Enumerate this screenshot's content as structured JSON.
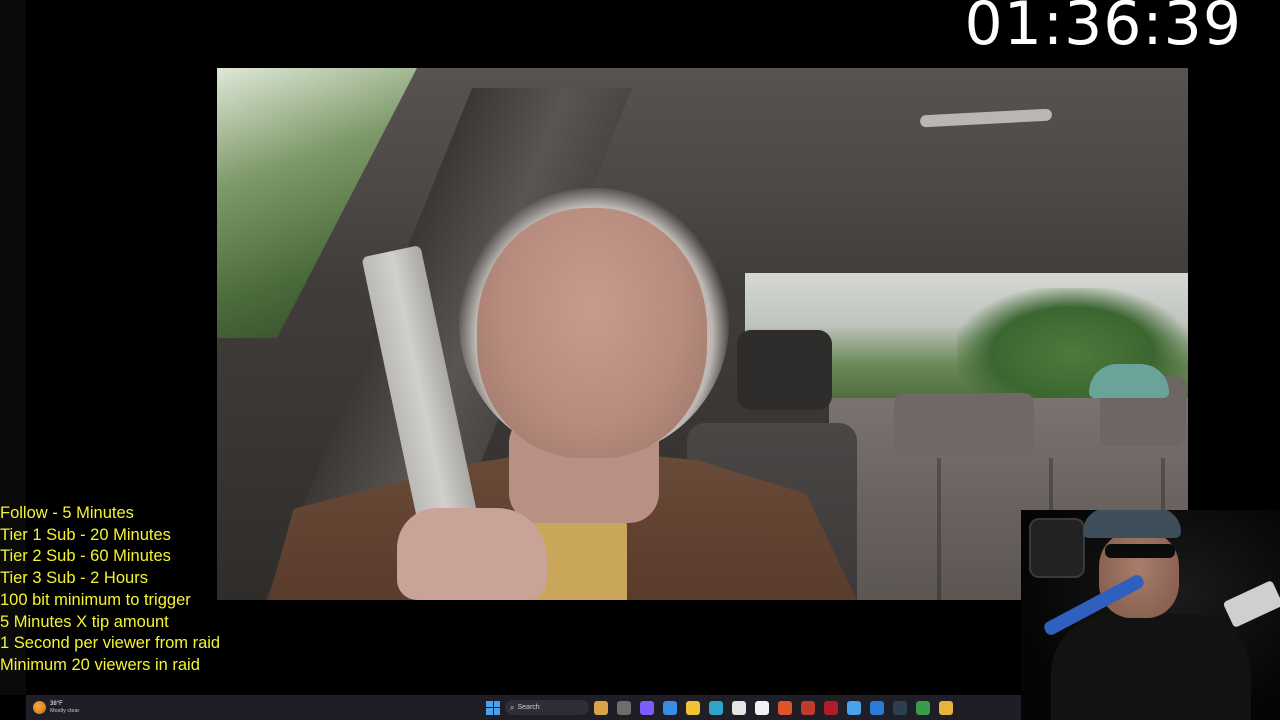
{
  "timer": {
    "value": "01:36:39"
  },
  "rules": [
    "Follow - 5 Minutes",
    "Tier 1 Sub - 20 Minutes",
    "Tier 2 Sub - 60 Minutes",
    "Tier 3 Sub - 2 Hours",
    "100 bit minimum to trigger",
    "5 Minutes X tip amount",
    "1 Second per viewer from raid",
    "Minimum 20 viewers in raid"
  ],
  "taskbar": {
    "weather_temp": "38°F",
    "weather_desc": "Mostly clear",
    "search_label": "Search",
    "apps": [
      {
        "name": "widgets-icon",
        "color": "#d9a24a"
      },
      {
        "name": "task-view-icon",
        "color": "#6d6d6d"
      },
      {
        "name": "chat-icon",
        "color": "#7b5cff"
      },
      {
        "name": "copilot-icon",
        "color": "#3a8ee6"
      },
      {
        "name": "file-explorer-icon",
        "color": "#f1c232"
      },
      {
        "name": "edge-icon",
        "color": "#2fa4c9"
      },
      {
        "name": "chrome-icon",
        "color": "#e5e5e5"
      },
      {
        "name": "calendar-icon",
        "color": "#f2f2f2"
      },
      {
        "name": "brave-icon",
        "color": "#e05228"
      },
      {
        "name": "game-icon",
        "color": "#c0392b"
      },
      {
        "name": "streamlabs-icon",
        "color": "#b01d2a"
      },
      {
        "name": "notepad-icon",
        "color": "#4aa3ea"
      },
      {
        "name": "photos-icon",
        "color": "#2b7bd8"
      },
      {
        "name": "obs-icon",
        "color": "#2c3e50"
      },
      {
        "name": "green-app-icon",
        "color": "#3b9b4a"
      },
      {
        "name": "chrome-alt-icon",
        "color": "#e8b33b"
      }
    ]
  }
}
